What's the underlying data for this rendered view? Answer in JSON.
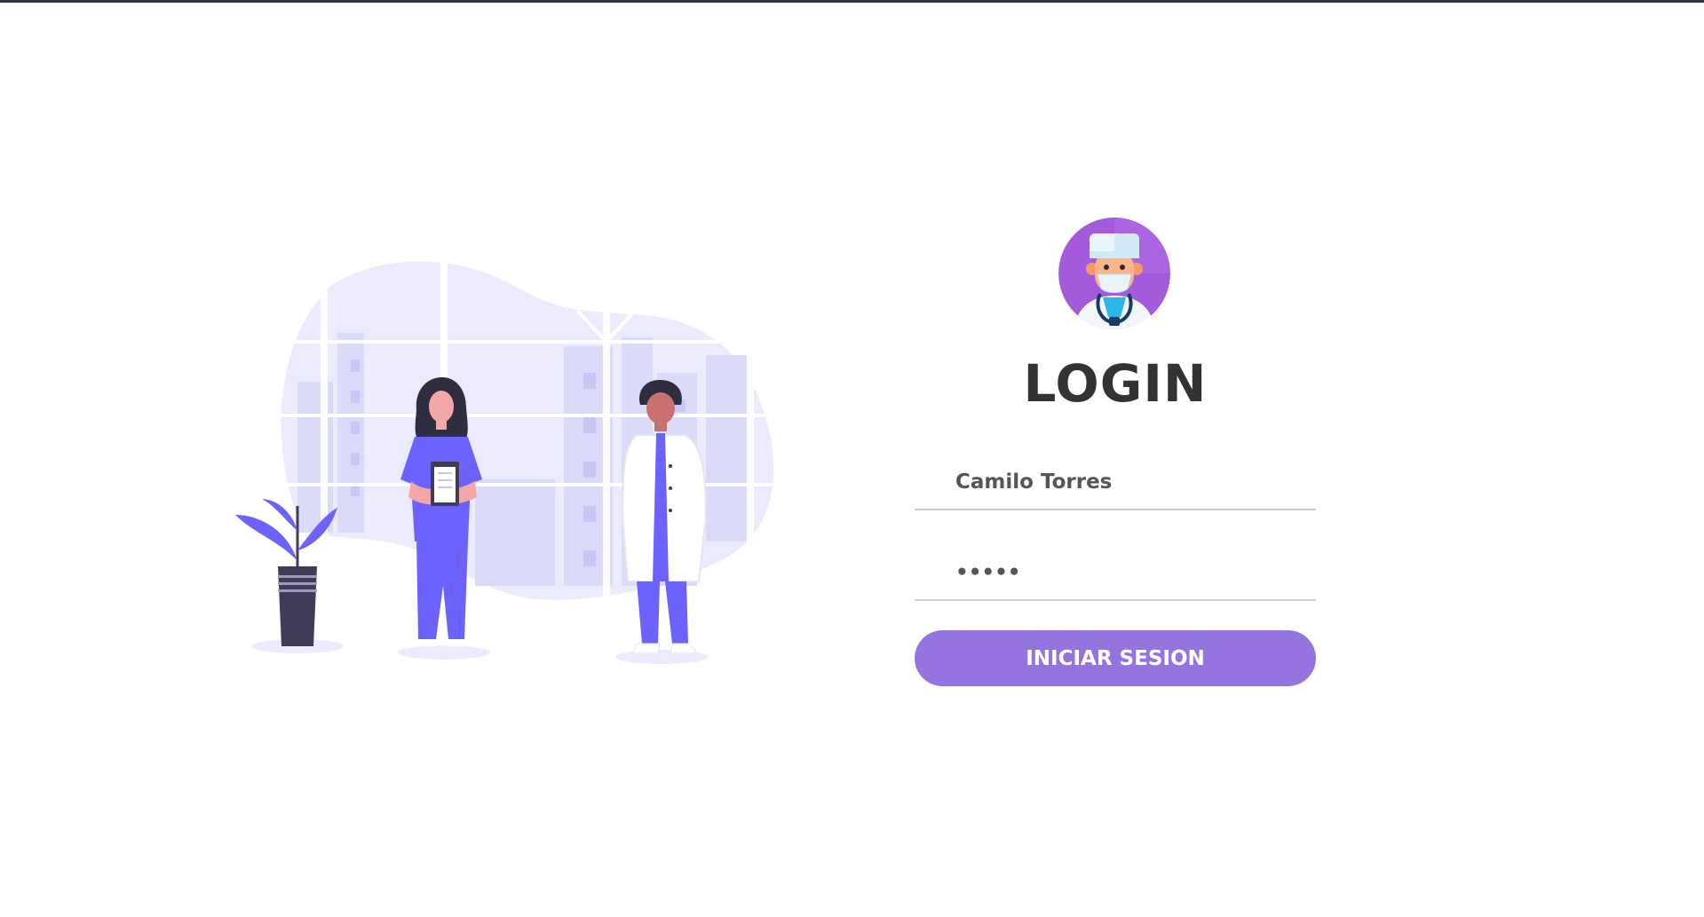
{
  "login": {
    "title": "LOGIN",
    "username": {
      "value": "Camilo Torres"
    },
    "password": {
      "value": "12345"
    },
    "submit_label": "INICIAR SESION"
  },
  "illustration": {
    "icon": "medical-staff-illustration"
  },
  "avatar": {
    "icon": "doctor-avatar-icon"
  },
  "colors": {
    "accent": "#9674df",
    "title": "#333333",
    "input_text": "#555555",
    "underline": "#d6c7d4",
    "scrub": "#6c63ff",
    "blob": "#ecebfd",
    "top_bar": "#2f3640"
  }
}
